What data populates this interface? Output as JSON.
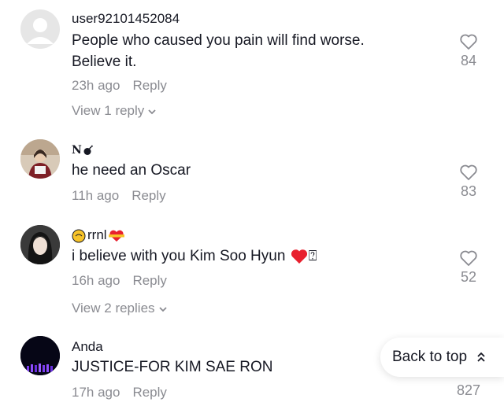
{
  "comments": [
    {
      "username": "user92101452084",
      "text_lines": [
        "People who caused you pain will find worse.",
        "Believe it."
      ],
      "time": "23h ago",
      "reply_label": "Reply",
      "likes": "84",
      "view_replies": "View 1 reply",
      "avatar": "default-avatar"
    },
    {
      "username": "N",
      "text_lines": [
        "he need an Oscar"
      ],
      "time": "11h ago",
      "reply_label": "Reply",
      "likes": "83",
      "avatar": "photo-avatar"
    },
    {
      "username": "rrnl",
      "text_lines": [
        "i believe with you Kim Soo Hyun"
      ],
      "text_suffix": "⍰",
      "time": "16h ago",
      "reply_label": "Reply",
      "likes": "52",
      "view_replies": "View 2 replies",
      "avatar": "photo-avatar"
    },
    {
      "username": "Anda",
      "text_lines": [
        "JUSTICE-FOR KIM SAE RON"
      ],
      "time": "17h ago",
      "reply_label": "Reply",
      "likes": "827",
      "avatar": "photo-avatar"
    }
  ],
  "back_to_top": "Back to top",
  "colors": {
    "text": "#161823",
    "secondary": "#8a8b91",
    "heart_red": "#e8202e"
  }
}
